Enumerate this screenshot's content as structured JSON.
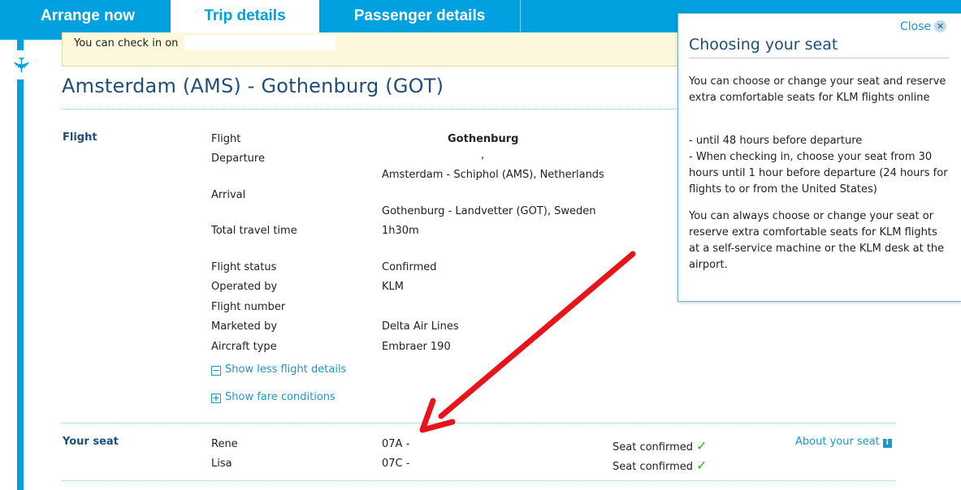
{
  "tabs": [
    {
      "label": "Arrange now"
    },
    {
      "label": "Trip details"
    },
    {
      "label": "Passenger details"
    }
  ],
  "notice": {
    "text": "You can check in on"
  },
  "route": {
    "title": "Amsterdam (AMS) - Gothenburg (GOT)"
  },
  "flight_section": {
    "label": "Flight",
    "rows": [
      {
        "label": "Flight",
        "value": "Gothenburg"
      },
      {
        "label": "Departure",
        "value": ",",
        "value2": "Amsterdam - Schiphol (AMS), Netherlands"
      },
      {
        "label": "Arrival",
        "value": "Gothenburg - Landvetter (GOT), Sweden"
      },
      {
        "label": "Total travel time",
        "value": "1h30m"
      },
      {
        "label": "Flight status",
        "value": "Confirmed"
      },
      {
        "label": "Operated by",
        "value": "KLM"
      },
      {
        "label": "Flight number",
        "value": ""
      },
      {
        "label": "Marketed by",
        "value": "Delta Air Lines"
      },
      {
        "label": "Aircraft type",
        "value": "Embraer 190"
      }
    ],
    "show_less_label": "Show less flight details",
    "show_fare_label": "Show fare conditions"
  },
  "seat_section": {
    "label": "Your seat",
    "about_label": "About your seat",
    "passengers": [
      {
        "name": "Rene",
        "seat": "07A -",
        "status": "Seat confirmed"
      },
      {
        "name": "Lisa",
        "seat": "07C -",
        "status": "Seat confirmed"
      }
    ]
  },
  "popup": {
    "close_label": "Close",
    "title": "Choosing your seat",
    "p1": "You can choose or change your seat and reserve extra comfortable seats for KLM flights online",
    "p2a": "- until 48 hours before departure",
    "p2b": "- When checking in, choose your seat from 30 hours until 1 hour before departure (24 hours for flights to or from the United States)",
    "p3": "You can always choose or change your seat or reserve extra comfortable seats for KLM flights at a self-service machine or the KLM desk at the airport."
  },
  "icons": {
    "plane": "plane-icon",
    "minus": "minus-box-icon",
    "plus": "plus-box-icon",
    "check": "checkmark-icon",
    "info": "info-icon",
    "close": "close-icon",
    "arrow": "red-arrow-annotation"
  },
  "colors": {
    "brand": "#00a1de",
    "title": "#1f4e79",
    "link": "#1a98c9",
    "confirm": "#3aaa35",
    "notice_bg": "#fdf7dc",
    "arrow": "#e8141c"
  }
}
